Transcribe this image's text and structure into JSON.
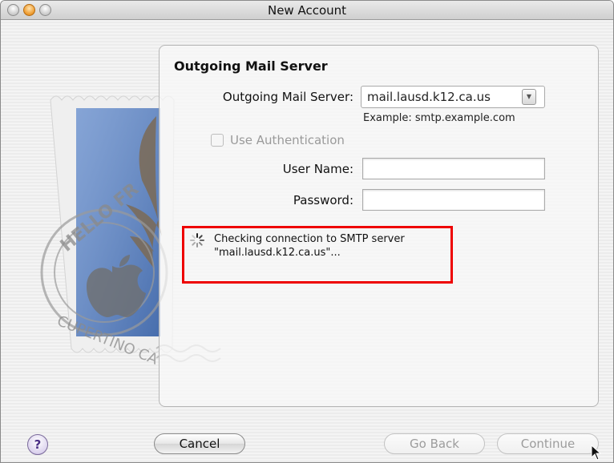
{
  "window": {
    "title": "New Account"
  },
  "panel": {
    "section_title": "Outgoing Mail Server",
    "outgoing_server": {
      "label": "Outgoing Mail Server:",
      "value": "mail.lausd.k12.ca.us",
      "example": "Example: smtp.example.com"
    },
    "use_authentication": {
      "label": "Use Authentication",
      "checked": false,
      "enabled": false
    },
    "username": {
      "label": "User Name:",
      "value": ""
    },
    "password": {
      "label": "Password:",
      "value": ""
    },
    "status": {
      "line1": "Checking connection to SMTP server",
      "line2": "\"mail.lausd.k12.ca.us\"..."
    }
  },
  "stamp": {
    "top_text": "HELLO FR",
    "bottom_text": "CUPERTINO CA"
  },
  "footer": {
    "help": "?",
    "cancel": "Cancel",
    "go_back": "Go Back",
    "continue": "Continue"
  },
  "colors": {
    "highlight_border": "#ee0000",
    "stamp_blue": "#5d86c8"
  }
}
